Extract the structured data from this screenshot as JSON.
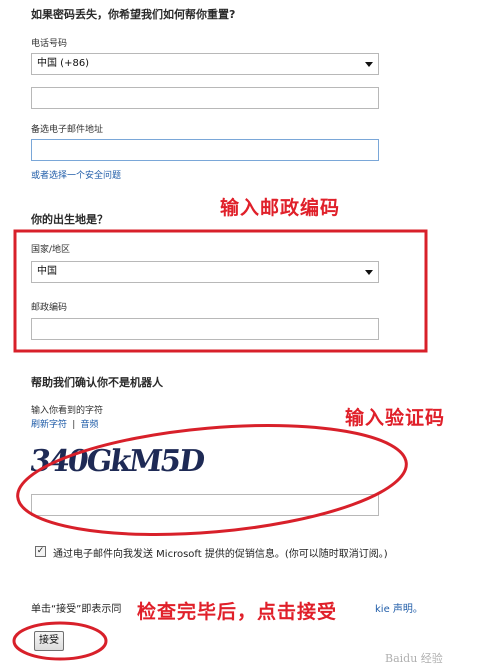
{
  "section_reset": {
    "title": "如果密码丢失，你希望我们如何帮你重置?",
    "phone_label": "电话号码",
    "phone_country": "中国 (+86)",
    "alt_email_label": "备选电子邮件地址",
    "security_link": "或者选择一个安全问题"
  },
  "section_birthplace": {
    "title": "你的出生地是？",
    "country_label": "国家/地区",
    "country_value": "中国",
    "postal_label": "邮政编码"
  },
  "section_captcha": {
    "title": "帮助我们确认你不是机器人",
    "instruction": "输入你看到的字符",
    "refresh_link": "刷新字符",
    "separator": "|",
    "audio_link": "音频",
    "captcha_text": "340GkM5D"
  },
  "promo": {
    "text": "通过电子邮件向我发送 Microsoft 提供的促销信息。(你可以随时取消订阅。)",
    "checked": true
  },
  "terms": {
    "prefix": "单击“接受”即表示同",
    "suffix": "kie 声明。"
  },
  "accept_button": "接受",
  "annotations": {
    "postal": "输入邮政编码",
    "captcha": "输入验证码",
    "accept": "检查完毕后，点击接受"
  },
  "watermark": "Baidu 经验",
  "colors": {
    "annotation_red": "#e0202a",
    "link_blue": "#1f5ca8"
  }
}
